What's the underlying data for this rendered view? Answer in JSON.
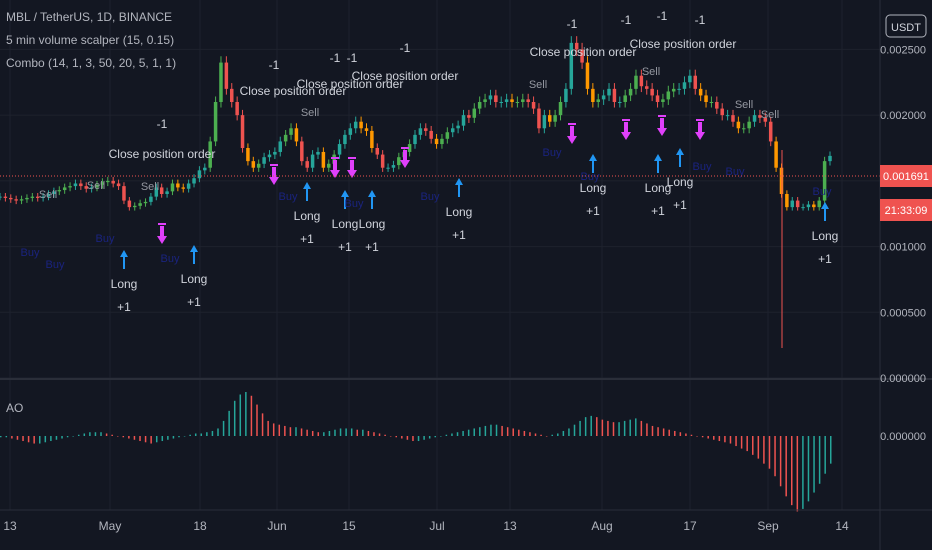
{
  "header": {
    "symbol_line": "MBL / TetherUS, 1D, BINANCE",
    "indicators": [
      "5 min volume scalper (15, 0.15)",
      "Combo (14, 1, 3, 50, 20, 5, 1, 1)"
    ],
    "currency_button": "USDT"
  },
  "ao_label": "AO",
  "price_tag": "0.001691",
  "countdown_tag": "21:33:09",
  "colors": {
    "background": "#131722",
    "bull": "#26a69a",
    "bear": "#ef5350",
    "strategy_bull": "#4caf50",
    "strategy_bear": "#ff9800",
    "close_marker": "#e040fb",
    "long_marker": "#2196f3",
    "short_label": "#1a237e"
  },
  "chart_data": [
    {
      "type": "candlestick",
      "title": "MBL / TetherUS, 1D, BINANCE",
      "y_axis_ticks": [
        "0.002500",
        "0.002000",
        "0.001500",
        "0.001000",
        "0.000500",
        "0.000000"
      ],
      "y_range": [
        0,
        0.0028
      ],
      "x_axis_ticks": [
        "13",
        "May",
        "18",
        "Jun",
        "15",
        "Jul",
        "13",
        "Aug",
        "17",
        "Sep",
        "14"
      ],
      "last_price": 0.001691,
      "close_series": [
        0.00138,
        0.00137,
        0.00136,
        0.00135,
        0.00136,
        0.00137,
        0.00138,
        0.00137,
        0.00138,
        0.0014,
        0.00142,
        0.00143,
        0.00145,
        0.00146,
        0.00148,
        0.00146,
        0.00144,
        0.00145,
        0.00147,
        0.00149,
        0.0015,
        0.00148,
        0.00146,
        0.00135,
        0.0013,
        0.00131,
        0.00133,
        0.00134,
        0.00138,
        0.00145,
        0.0014,
        0.00142,
        0.00148,
        0.00145,
        0.00144,
        0.00148,
        0.00152,
        0.00158,
        0.0016,
        0.0018,
        0.0021,
        0.0024,
        0.0022,
        0.0021,
        0.002,
        0.00175,
        0.00165,
        0.0016,
        0.00163,
        0.00168,
        0.0017,
        0.00172,
        0.0018,
        0.00185,
        0.0019,
        0.0018,
        0.00165,
        0.0016,
        0.0017,
        0.00172,
        0.0016,
        0.00163,
        0.0017,
        0.00178,
        0.00185,
        0.0019,
        0.00195,
        0.0019,
        0.00188,
        0.00175,
        0.0017,
        0.0016,
        0.0016,
        0.00162,
        0.00168,
        0.00172,
        0.00178,
        0.00185,
        0.0019,
        0.00188,
        0.00182,
        0.00178,
        0.00182,
        0.00187,
        0.0019,
        0.00192,
        0.002,
        0.00198,
        0.00205,
        0.0021,
        0.00212,
        0.00215,
        0.0021,
        0.0021,
        0.00212,
        0.0021,
        0.0021,
        0.00212,
        0.0021,
        0.00205,
        0.0019,
        0.002,
        0.00195,
        0.002,
        0.0021,
        0.0022,
        0.00255,
        0.0025,
        0.0024,
        0.0022,
        0.0021,
        0.00212,
        0.00215,
        0.0022,
        0.0021,
        0.0021,
        0.00215,
        0.0022,
        0.0023,
        0.00222,
        0.0022,
        0.00215,
        0.0021,
        0.00212,
        0.00218,
        0.0022,
        0.0022,
        0.00225,
        0.0023,
        0.0022,
        0.00215,
        0.0021,
        0.0021,
        0.00205,
        0.002,
        0.002,
        0.00195,
        0.0019,
        0.0019,
        0.00195,
        0.002,
        0.00198,
        0.00195,
        0.0018,
        0.0016,
        0.0014,
        0.0013,
        0.00135,
        0.0013,
        0.0013,
        0.00132,
        0.0013,
        0.00135,
        0.00165,
        0.00169
      ],
      "annotations": {
        "long_entry_texts": [
          "Long",
          "+1"
        ],
        "close_order_texts": [
          "-1",
          "Close position order"
        ],
        "sell_label": "Sell",
        "buy_label": "Buy"
      }
    },
    {
      "type": "bar",
      "title": "AO",
      "y_axis_ticks": [
        "0.000000"
      ],
      "values": [
        -1e-05,
        -1e-05,
        -2e-05,
        -3e-05,
        -4e-05,
        -5e-05,
        -6e-05,
        -6e-05,
        -5e-05,
        -4e-05,
        -3e-05,
        -2e-05,
        -1e-05,
        0,
        1e-05,
        2e-05,
        3e-05,
        3e-05,
        3e-05,
        2e-05,
        1e-05,
        0,
        -1e-05,
        -2e-05,
        -3e-05,
        -4e-05,
        -5e-05,
        -6e-05,
        -5e-05,
        -4e-05,
        -3e-05,
        -2e-05,
        -1e-05,
        0,
        1e-05,
        2e-05,
        2e-05,
        3e-05,
        4e-05,
        6e-05,
        0.00012,
        0.0002,
        0.00028,
        0.00033,
        0.00035,
        0.00032,
        0.00025,
        0.00018,
        0.00012,
        0.0001,
        9e-05,
        8e-05,
        7e-05,
        7e-05,
        6e-05,
        5e-05,
        4e-05,
        3e-05,
        3e-05,
        4e-05,
        5e-05,
        6e-05,
        6e-05,
        6e-05,
        5e-05,
        5e-05,
        4e-05,
        3e-05,
        2e-05,
        1e-05,
        0,
        -1e-05,
        -2e-05,
        -3e-05,
        -4e-05,
        -4e-05,
        -3e-05,
        -2e-05,
        -1e-05,
        0,
        1e-05,
        2e-05,
        3e-05,
        4e-05,
        5e-05,
        6e-05,
        7e-05,
        8e-05,
        9e-05,
        9e-05,
        8e-05,
        7e-05,
        6e-05,
        5e-05,
        4e-05,
        3e-05,
        2e-05,
        1e-05,
        0,
        1e-05,
        2e-05,
        4e-05,
        6e-05,
        9e-05,
        0.00012,
        0.00015,
        0.00016,
        0.00015,
        0.00013,
        0.00012,
        0.00011,
        0.00011,
        0.00012,
        0.00013,
        0.00014,
        0.00012,
        0.0001,
        8e-05,
        7e-05,
        6e-05,
        5e-05,
        4e-05,
        3e-05,
        2e-05,
        1e-05,
        0,
        -1e-05,
        -2e-05,
        -3e-05,
        -4e-05,
        -5e-05,
        -6e-05,
        -8e-05,
        -0.0001,
        -0.00012,
        -0.00015,
        -0.00018,
        -0.00022,
        -0.00026,
        -0.00032,
        -0.0004,
        -0.00048,
        -0.00055,
        -0.0006,
        -0.00058,
        -0.00052,
        -0.00045,
        -0.00038,
        -0.0003,
        -0.00022
      ]
    }
  ]
}
